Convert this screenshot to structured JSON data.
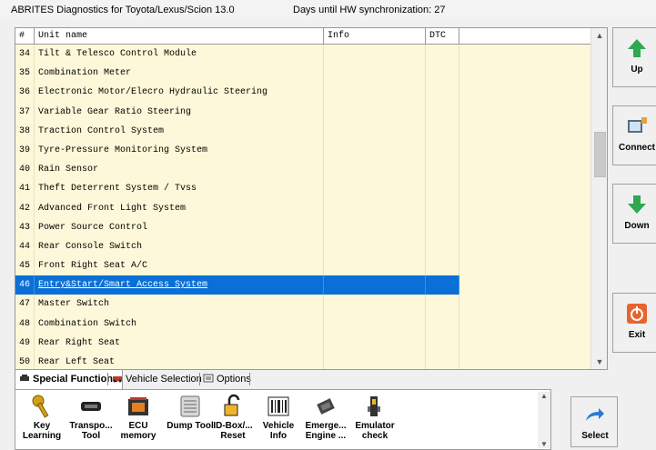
{
  "titlebar": {
    "app_title": "ABRITES Diagnostics for Toyota/Lexus/Scion 13.0",
    "hw_sync": "Days until HW synchronization: 27"
  },
  "grid": {
    "columns": [
      "#",
      "Unit name",
      "Info",
      "DTC"
    ],
    "rows": [
      {
        "num": "34",
        "name": "Tilt & Telesco Control Module"
      },
      {
        "num": "35",
        "name": "Combination Meter"
      },
      {
        "num": "36",
        "name": "Electronic Motor/Elecro Hydraulic Steering"
      },
      {
        "num": "37",
        "name": "Variable Gear Ratio Steering"
      },
      {
        "num": "38",
        "name": "Traction Control System"
      },
      {
        "num": "39",
        "name": "Tyre-Pressure Monitoring System"
      },
      {
        "num": "40",
        "name": "Rain Sensor"
      },
      {
        "num": "41",
        "name": "Theft Deterrent System / Tvss"
      },
      {
        "num": "42",
        "name": "Advanced Front Light System"
      },
      {
        "num": "43",
        "name": "Power Source Control"
      },
      {
        "num": "44",
        "name": "Rear Console Switch"
      },
      {
        "num": "45",
        "name": "Front Right Seat A/C"
      },
      {
        "num": "46",
        "name": "Entry&Start/Smart Access System",
        "selected": true
      },
      {
        "num": "47",
        "name": "Master Switch"
      },
      {
        "num": "48",
        "name": "Combination Switch"
      },
      {
        "num": "49",
        "name": "Rear Right Seat"
      },
      {
        "num": "50",
        "name": "Rear Left Seat"
      }
    ]
  },
  "side_buttons": {
    "up": "Up",
    "connect": "Connect",
    "down": "Down",
    "exit": "Exit"
  },
  "tabs": {
    "special": "Special Functions",
    "vehicle": "Vehicle Selection",
    "options": "Options"
  },
  "tools": [
    {
      "l1": "Key",
      "l2": "Learning",
      "icon": "key-icon"
    },
    {
      "l1": "Transpo...",
      "l2": "Tool",
      "icon": "transponder-icon"
    },
    {
      "l1": "ECU",
      "l2": "memory",
      "icon": "ecu-icon"
    },
    {
      "l1": "Dump Tool",
      "l2": "",
      "icon": "dump-tool-icon"
    },
    {
      "l1": "ID-Box/...",
      "l2": "Reset",
      "icon": "padlock-icon"
    },
    {
      "l1": "Vehicle",
      "l2": "Info",
      "icon": "barcode-icon"
    },
    {
      "l1": "Emerge...",
      "l2": "Engine ...",
      "icon": "chip-icon"
    },
    {
      "l1": "Emulator",
      "l2": "check",
      "icon": "emulator-icon"
    }
  ],
  "select_button": "Select",
  "colors": {
    "row_bg": "#fdf8d9",
    "selection": "#0a6fd6",
    "arrow_green": "#2fa84f",
    "exit_orange": "#e8642c"
  }
}
